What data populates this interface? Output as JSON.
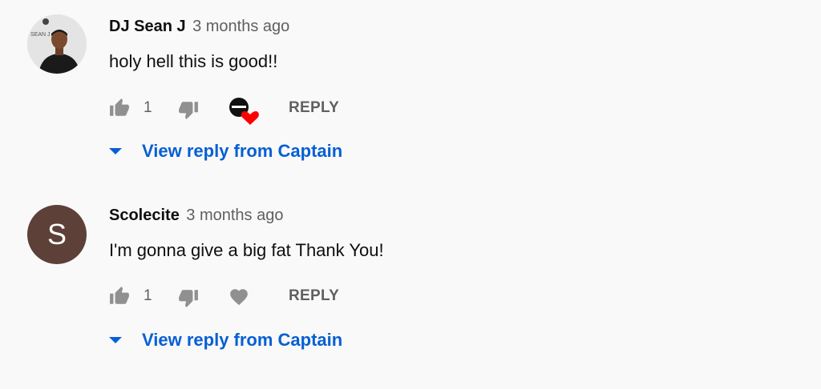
{
  "colors": {
    "background": "#f9f9f9",
    "text_primary": "#0f0f0f",
    "text_secondary": "#606060",
    "link_blue": "#065fd4",
    "heart_red": "#ff0000",
    "letter_avatar_bg": "#5d4037"
  },
  "comments": [
    {
      "author": "DJ Sean J",
      "timestamp": "3 months ago",
      "text": "holy hell this is good!!",
      "avatar_type": "photo",
      "avatar_caption": "SEAN J",
      "like_count": "1",
      "creator_hearted": true,
      "reply_label": "REPLY",
      "view_replies_label": "View reply from Captain",
      "icons": [
        "thumbs-up-icon",
        "thumbs-down-icon",
        "creator-heart-icon",
        "caret-down-icon"
      ]
    },
    {
      "author": "Scolecite",
      "timestamp": "3 months ago",
      "text": "I'm gonna give a big fat Thank You!",
      "avatar_type": "letter",
      "avatar_letter": "S",
      "like_count": "1",
      "creator_hearted": false,
      "reply_label": "REPLY",
      "view_replies_label": "View reply from Captain",
      "icons": [
        "thumbs-up-icon",
        "thumbs-down-icon",
        "heart-outline-icon",
        "caret-down-icon"
      ]
    }
  ]
}
